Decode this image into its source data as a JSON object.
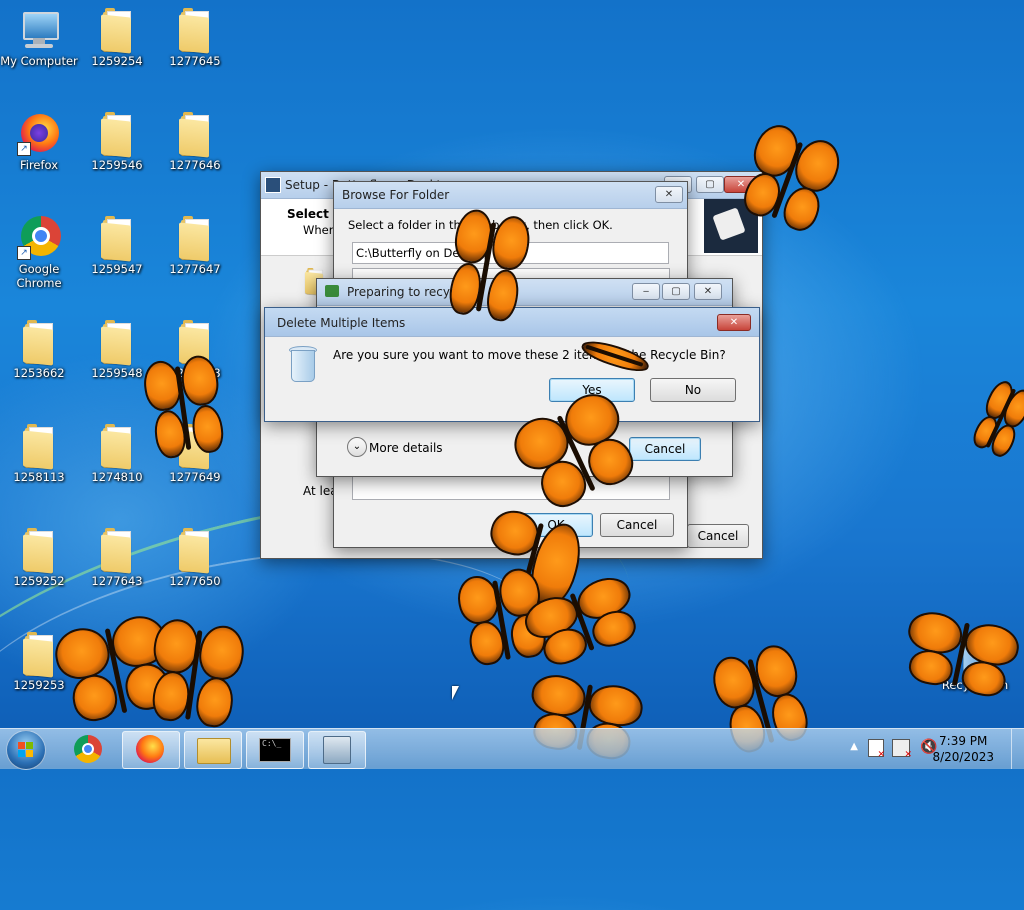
{
  "desktop": {
    "icons": [
      {
        "label": "My Computer",
        "icon": "computer-icon"
      },
      {
        "label": "1259254",
        "icon": "folder-icon"
      },
      {
        "label": "1277645",
        "icon": "folder-icon"
      },
      {
        "label": "Firefox",
        "icon": "firefox-icon"
      },
      {
        "label": "1259546",
        "icon": "folder-icon"
      },
      {
        "label": "1277646",
        "icon": "folder-icon"
      },
      {
        "label": "Google Chrome",
        "icon": "chrome-icon"
      },
      {
        "label": "1259547",
        "icon": "folder-icon"
      },
      {
        "label": "1277647",
        "icon": "folder-icon"
      },
      {
        "label": "1253662",
        "icon": "folder-icon"
      },
      {
        "label": "1259548",
        "icon": "folder-icon"
      },
      {
        "label": "1277648",
        "icon": "folder-icon"
      },
      {
        "label": "1258113",
        "icon": "folder-icon"
      },
      {
        "label": "1274810",
        "icon": "folder-icon"
      },
      {
        "label": "1277649",
        "icon": "folder-icon"
      },
      {
        "label": "1259252",
        "icon": "folder-icon"
      },
      {
        "label": "1277643",
        "icon": "folder-icon"
      },
      {
        "label": "1277650",
        "icon": "folder-icon"
      },
      {
        "label": "1259253",
        "icon": "folder-icon"
      },
      {
        "label": "Recycle Bin",
        "icon": "recycle-bin-icon"
      }
    ]
  },
  "setup_window": {
    "title": "Setup - Butterfly on Desktop",
    "heading": "Select D",
    "subtext": "Where",
    "footer_text": "At leas",
    "cancel_label": "Cancel"
  },
  "browse_dialog": {
    "title": "Browse For Folder",
    "instruction": "Select a folder in the list below, then click OK.",
    "path_value": "C:\\Butterfly on Desktop",
    "ok_label": "OK",
    "cancel_label": "Cancel"
  },
  "recycle_progress": {
    "title": "Preparing to recycle",
    "more_details_label": "More details",
    "cancel_label": "Cancel"
  },
  "delete_dialog": {
    "title": "Delete Multiple Items",
    "message": "Are you sure you want to move these 2 items to the Recycle Bin?",
    "yes_label": "Yes",
    "no_label": "No"
  },
  "taskbar": {
    "start": "start-orb-icon",
    "items": [
      "chrome-icon",
      "firefox-icon",
      "file-explorer-icon",
      "command-prompt-icon",
      "setup-installer-icon"
    ],
    "time": "7:39 PM",
    "date": "8/20/2023"
  },
  "colors": {
    "butterfly": "#f07c0a",
    "desktop": "#1a86da",
    "titlebar": "#b7cfeb"
  }
}
